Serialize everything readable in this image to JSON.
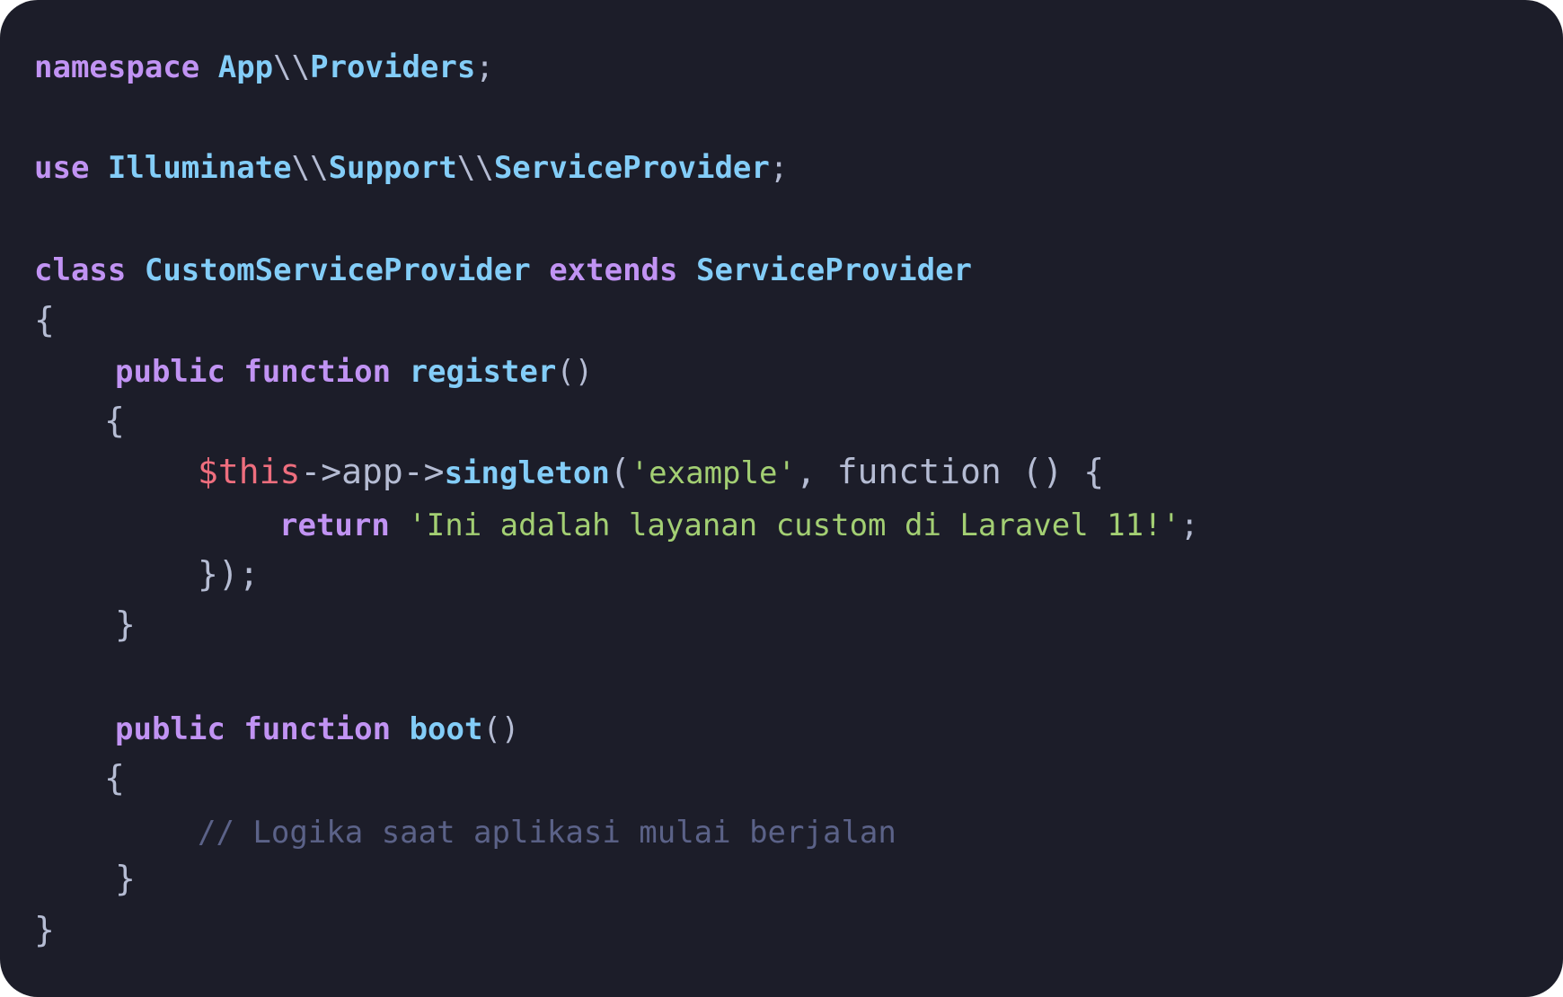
{
  "code": {
    "line1": {
      "kw": "namespace",
      "ns1": "App",
      "sep": "\\\\",
      "ns2": "Providers",
      "end": ";"
    },
    "line3": {
      "kw": "use",
      "ns1": "Illuminate",
      "sep1": "\\\\",
      "ns2": "Support",
      "sep2": "\\\\",
      "ns3": "ServiceProvider",
      "end": ";"
    },
    "line5": {
      "kw1": "class",
      "cls": "CustomServiceProvider",
      "kw2": "extends",
      "parent": "ServiceProvider"
    },
    "line6": {
      "brace": "{"
    },
    "line7": {
      "kw1": "public",
      "kw2": "function",
      "fn": "register",
      "parens": "()"
    },
    "line8": {
      "brace": "{"
    },
    "line9": {
      "var": "$this",
      "arrow1": "->",
      "prop": "app",
      "arrow2": "->",
      "method": "singleton",
      "open": "(",
      "str": "'example'",
      "rest": ", function () {"
    },
    "line10": {
      "kw": "return",
      "str": "'Ini adalah layanan custom di Laravel 11!'",
      "end": ";"
    },
    "line11": {
      "text": "});"
    },
    "line12": {
      "brace": "}"
    },
    "line14": {
      "kw1": "public",
      "kw2": "function",
      "fn": "boot",
      "parens": "()"
    },
    "line15": {
      "brace": "{"
    },
    "line16": {
      "comment": "// Logika saat aplikasi mulai berjalan"
    },
    "line17": {
      "brace": "}"
    },
    "line18": {
      "brace": "}"
    }
  },
  "colors": {
    "background": "#1c1d29",
    "keyword": "#c193f3",
    "type": "#83cdf8",
    "string": "#a3cf73",
    "variable": "#ee6e7e",
    "comment": "#5b6288",
    "punctuation": "#b5bcd3"
  }
}
